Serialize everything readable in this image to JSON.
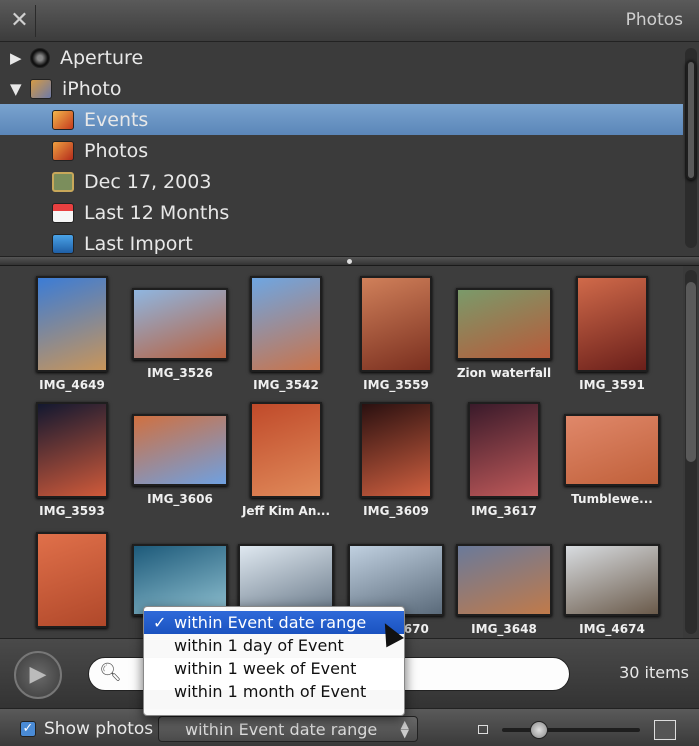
{
  "window": {
    "title": "Photos",
    "close_glyph": "✕"
  },
  "source_list": {
    "items": [
      {
        "label": "Aperture",
        "disclosure": "▶",
        "icon": "aperture-icon"
      },
      {
        "label": "iPhoto",
        "disclosure": "▼",
        "icon": "iphoto-icon"
      },
      {
        "label": "Events",
        "icon": "events-icon",
        "selected": true
      },
      {
        "label": "Photos",
        "icon": "photos-icon"
      },
      {
        "label": "Dec 17, 2003",
        "icon": "calendar-date-icon"
      },
      {
        "label": "Last 12 Months",
        "icon": "calendar-icon"
      },
      {
        "label": "Last Import",
        "icon": "import-icon"
      }
    ]
  },
  "photos": [
    {
      "caption": "IMG_4649",
      "colors": [
        "#3b7cd6",
        "#c8955a"
      ]
    },
    {
      "caption": "IMG_3526",
      "colors": [
        "#8fb6e0",
        "#b8603e"
      ]
    },
    {
      "caption": "IMG_3542",
      "colors": [
        "#6ea6e2",
        "#c9734a"
      ]
    },
    {
      "caption": "IMG_3559",
      "colors": [
        "#d0805a",
        "#7a2f1f"
      ]
    },
    {
      "caption": "Zion waterfall",
      "colors": [
        "#7a9a6a",
        "#b85a3a"
      ]
    },
    {
      "caption": "IMG_3591",
      "colors": [
        "#d06a4a",
        "#6a1f1a"
      ]
    },
    {
      "caption": "IMG_3593",
      "colors": [
        "#121830",
        "#d05a3a"
      ]
    },
    {
      "caption": "IMG_3606",
      "colors": [
        "#d07040",
        "#6fa0e0"
      ]
    },
    {
      "caption": "Jeff Kim An...",
      "colors": [
        "#c04a2a",
        "#e08a5a"
      ]
    },
    {
      "caption": "IMG_3609",
      "colors": [
        "#2a1010",
        "#d06040"
      ]
    },
    {
      "caption": "IMG_3617",
      "colors": [
        "#3a1a2a",
        "#c05a5a"
      ]
    },
    {
      "caption": "Tumblewe...",
      "colors": [
        "#e0886a",
        "#c0603a"
      ]
    },
    {
      "caption": "",
      "colors": [
        "#e0704a",
        "#b0482a"
      ]
    },
    {
      "caption": "",
      "colors": [
        "#1d5a7a",
        "#8fc0d0"
      ]
    },
    {
      "caption": "",
      "colors": [
        "#dfe8f0",
        "#6a7a8a"
      ]
    },
    {
      "caption": "IMG_3670",
      "colors": [
        "#c0d0e0",
        "#5a6a7a"
      ]
    },
    {
      "caption": "IMG_3648",
      "colors": [
        "#6a7a9a",
        "#c07a4a"
      ]
    },
    {
      "caption": "IMG_4674",
      "colors": [
        "#d8dce0",
        "#6a5a4a"
      ]
    }
  ],
  "search": {
    "placeholder": "",
    "icon": "search-icon"
  },
  "items_count": "30 items",
  "play": {
    "icon": "play-icon",
    "glyph": "▶"
  },
  "bottom": {
    "show_photos_label": "Show photos",
    "show_photos_checked": true,
    "select_value": "within Event date range",
    "select_arrows": "▲▼"
  },
  "menu": {
    "items": [
      {
        "label": "within Event date range",
        "checked": true
      },
      {
        "label": "within 1 day of Event",
        "checked": false
      },
      {
        "label": "within 1 week of Event",
        "checked": false
      },
      {
        "label": "within 1 month of Event",
        "checked": false
      }
    ],
    "check_glyph": "✓"
  }
}
